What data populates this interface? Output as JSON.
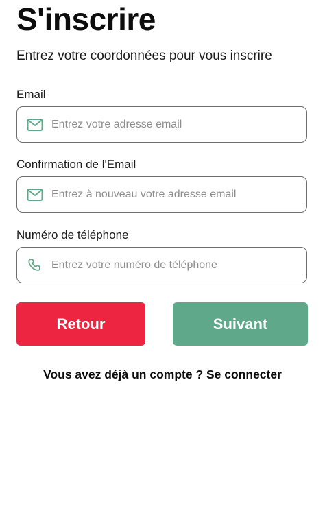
{
  "header": {
    "title": "S'inscrire",
    "subtitle": "Entrez votre coordonnées pour vous inscrire"
  },
  "form": {
    "email": {
      "label": "Email",
      "placeholder": "Entrez votre adresse email",
      "icon": "mail-icon"
    },
    "email_confirm": {
      "label": "Confirmation de l'Email",
      "placeholder": "Entrez à nouveau votre adresse email",
      "icon": "mail-icon"
    },
    "phone": {
      "label": "Numéro de téléphone",
      "placeholder": "Entrez votre numéro de téléphone",
      "icon": "phone-icon"
    }
  },
  "actions": {
    "back_label": "Retour",
    "next_label": "Suivant"
  },
  "footer": {
    "login_prompt": "Vous avez déjà un compte ? Se connecter"
  },
  "colors": {
    "back_button": "#ee2541",
    "next_button": "#5fa98a",
    "icon_accent": "#5fa98a",
    "field_border": "#6e6e6e"
  }
}
